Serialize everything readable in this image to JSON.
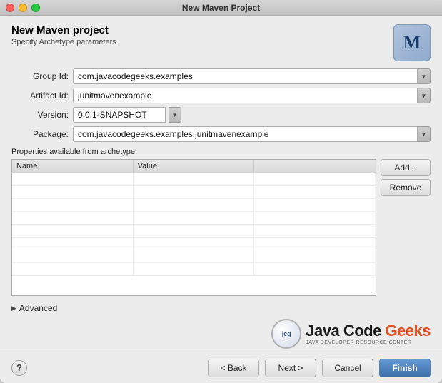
{
  "window": {
    "title": "New Maven Project"
  },
  "header": {
    "title": "New Maven project",
    "subtitle": "Specify Archetype parameters",
    "icon_letter": "M"
  },
  "form": {
    "group_id_label": "Group Id:",
    "group_id_value": "com.javacodegeeks.examples",
    "artifact_id_label": "Artifact Id:",
    "artifact_id_value": "junitmavenexample",
    "version_label": "Version:",
    "version_value": "0.0.1-SNAPSHOT",
    "package_label": "Package:",
    "package_value": "com.javacodegeeks.examples.junitmavenexample"
  },
  "properties": {
    "label": "Properties available from archetype:",
    "columns": [
      "Name",
      "Value",
      ""
    ],
    "add_button": "Add...",
    "remove_button": "Remove"
  },
  "advanced": {
    "label": "Advanced"
  },
  "branding": {
    "circle_text": "jcg",
    "main_text_1": "Java Code ",
    "main_text_2": "Geeks",
    "sub_text": "JAVA DEVELOPER RESOURCE CENTER"
  },
  "footer": {
    "back_button": "< Back",
    "next_button": "Next >",
    "cancel_button": "Cancel",
    "finish_button": "Finish"
  }
}
